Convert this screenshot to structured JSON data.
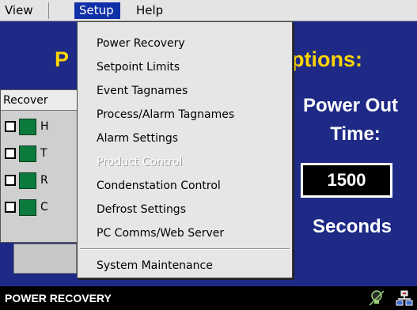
{
  "menubar": {
    "view": "View",
    "setup": "Setup",
    "help": "Help"
  },
  "background_title": {
    "left": "P",
    "right": ")ptions:"
  },
  "recovery_panel": {
    "header": "Recover",
    "items": [
      {
        "label": "H"
      },
      {
        "label": "T"
      },
      {
        "label": "R"
      },
      {
        "label": "C"
      }
    ]
  },
  "right_panel": {
    "power_out": "Power Out",
    "time": "Time:",
    "time_value": "1500",
    "units": "Seconds"
  },
  "setup_menu": {
    "items": [
      {
        "label": "Power Recovery"
      },
      {
        "label": "Setpoint Limits"
      },
      {
        "label": "Event Tagnames"
      },
      {
        "label": "Process/Alarm Tagnames"
      },
      {
        "label": "Alarm Settings"
      },
      {
        "label": "Product Control",
        "disabled": true
      },
      {
        "label": "Condenstation Control"
      },
      {
        "label": "Defrost Settings"
      },
      {
        "label": "PC Comms/Web Server"
      },
      {
        "label": "System Maintenance"
      }
    ]
  },
  "status": {
    "text": "POWER RECOVERY"
  },
  "icons": {
    "status_1": "lightbulb-icon",
    "status_2": "network-icon"
  },
  "colors": {
    "background": "#1e2a86",
    "title": "#ffd400",
    "menu_highlight": "#1030a8",
    "led": "#0c7a3c"
  }
}
